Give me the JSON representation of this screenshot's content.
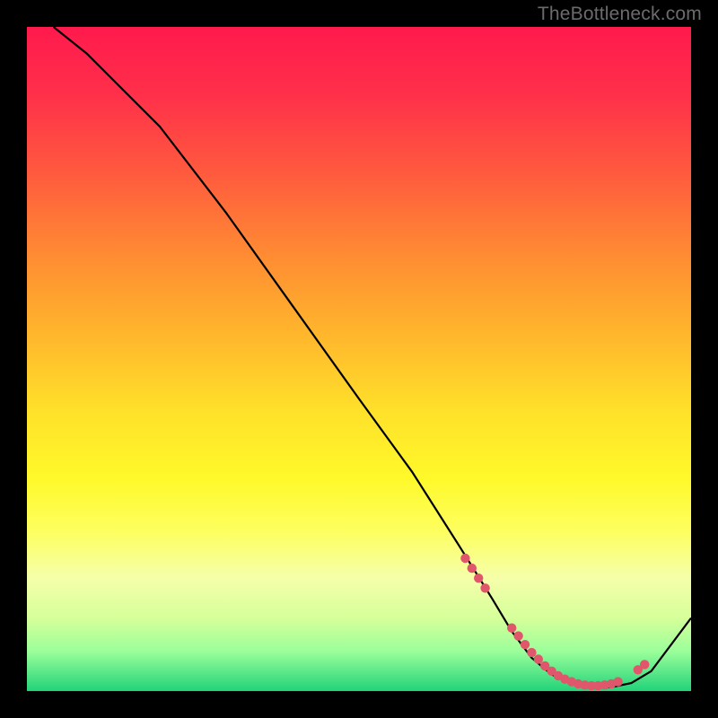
{
  "watermark": "TheBottleneck.com",
  "chart_data": {
    "type": "line",
    "title": "",
    "xlabel": "",
    "ylabel": "",
    "xlim": [
      0,
      100
    ],
    "ylim": [
      0,
      100
    ],
    "grid": false,
    "series": [
      {
        "name": "bottleneck-curve",
        "x": [
          4,
          9,
          14,
          20,
          30,
          40,
          50,
          58,
          65,
          70,
          73,
          76,
          79,
          82,
          85,
          88,
          91,
          94,
          100
        ],
        "y": [
          100,
          96,
          91,
          85,
          72,
          58,
          44,
          33,
          22,
          14,
          9,
          5,
          2.5,
          1.2,
          0.6,
          0.6,
          1.2,
          3,
          11
        ]
      }
    ],
    "markers": {
      "name": "highlight-cluster",
      "color": "#e0566b",
      "points_x": [
        66,
        67,
        68,
        69,
        73,
        74,
        75,
        76,
        77,
        78,
        79,
        80,
        81,
        82,
        83,
        84,
        85,
        86,
        87,
        88,
        89,
        92,
        93
      ],
      "points_y": [
        20,
        18.5,
        17,
        15.5,
        9.5,
        8.3,
        7,
        5.8,
        4.8,
        3.8,
        3,
        2.3,
        1.8,
        1.4,
        1.1,
        0.9,
        0.8,
        0.8,
        0.9,
        1.1,
        1.4,
        3.2,
        4
      ]
    }
  }
}
